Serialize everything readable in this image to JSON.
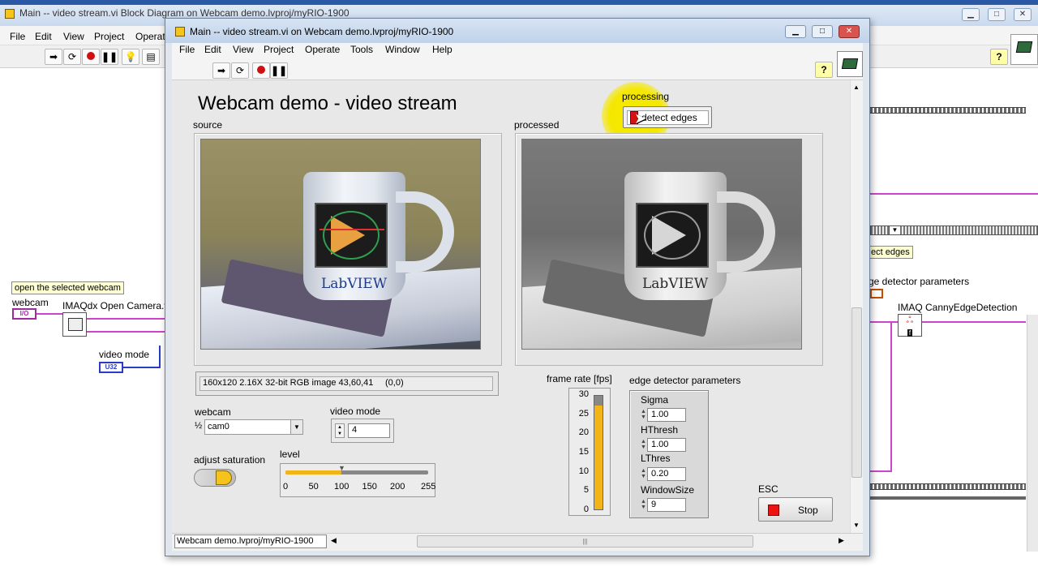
{
  "background_window": {
    "title": "Main -- video stream.vi Block Diagram on Webcam demo.lvproj/myRIO-1900",
    "menu": [
      "File",
      "Edit",
      "View",
      "Project",
      "Operate"
    ],
    "diagram": {
      "comment_label": "open the selected webcam",
      "webcam_label": "webcam",
      "webcam_terminal": "I/O",
      "open_camera_label": "IMAQdx Open Camera.vi",
      "video_mode_label": "video mode",
      "video_mode_terminal": "U32",
      "detect_edges_label": "ect edges",
      "edge_params_label": "ge detector parameters",
      "canny_label": "IMAQ CannyEdgeDetection",
      "canny_icon_text": "f"
    }
  },
  "front_panel": {
    "title": "Main -- video stream.vi on Webcam demo.lvproj/myRIO-1900",
    "menu": [
      "File",
      "Edit",
      "View",
      "Project",
      "Operate",
      "Tools",
      "Window",
      "Help"
    ],
    "heading": "Webcam demo - video stream",
    "source_label": "source",
    "processed_label": "processed",
    "processing_label": "processing",
    "processing_button": "detect edges",
    "image_info": "160x120 2.16X 32-bit RGB image 43,60,41",
    "image_coords": "(0,0)",
    "webcam": {
      "label": "webcam",
      "value": "cam0",
      "index_glyph": "½"
    },
    "video_mode": {
      "label": "video mode",
      "value": "4"
    },
    "adjust_saturation_label": "adjust saturation",
    "level": {
      "label": "level",
      "ticks": [
        "0",
        "50",
        "100",
        "150",
        "200",
        "255"
      ],
      "value": 100,
      "max": 255
    },
    "frame_rate": {
      "label": "frame rate [fps]",
      "ticks": [
        "30",
        "25",
        "20",
        "15",
        "10",
        "5",
        "0"
      ],
      "value": 27,
      "max": 30
    },
    "edge_params": {
      "label": "edge detector parameters",
      "sigma_label": "Sigma",
      "sigma_value": "1.00",
      "hthresh_label": "HThresh",
      "hthresh_value": "1.00",
      "lthres_label": "LThres",
      "lthres_value": "0.20",
      "windowsize_label": "WindowSize",
      "windowsize_value": "9"
    },
    "esc_label": "ESC",
    "stop_button": "Stop",
    "status_path": "Webcam demo.lvproj/myRIO-1900",
    "mug_text": "LabVIEW",
    "colors": {
      "stop_red": "#ee1111",
      "frame_fill": "#f3b418",
      "cursor_highlight": "#f5e800"
    }
  }
}
